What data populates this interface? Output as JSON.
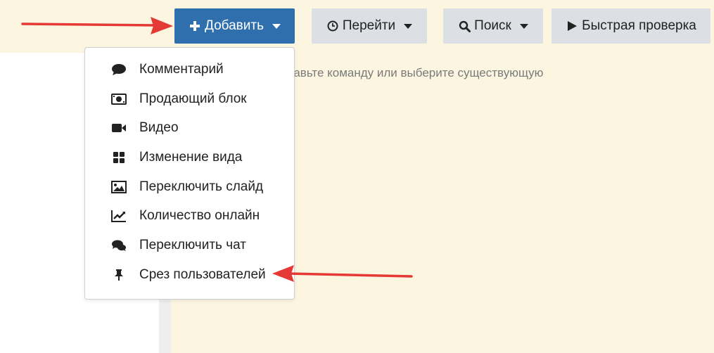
{
  "toolbar": {
    "add_label": "Добавить",
    "go_label": "Перейти",
    "search_label": "Поиск",
    "quick_check_label": "Быстрая проверка"
  },
  "main": {
    "hint": "бавьте команду или выберите существующую"
  },
  "menu": {
    "items": [
      {
        "label": "Комментарий",
        "icon": "comment-icon"
      },
      {
        "label": "Продающий блок",
        "icon": "money-icon"
      },
      {
        "label": "Видео",
        "icon": "video-camera-icon"
      },
      {
        "label": "Изменение вида",
        "icon": "grid-icon"
      },
      {
        "label": "Переключить слайд",
        "icon": "image-icon"
      },
      {
        "label": "Количество онлайн",
        "icon": "line-chart-icon"
      },
      {
        "label": "Переключить чат",
        "icon": "chat-bubbles-icon"
      },
      {
        "label": "Срез пользователей",
        "icon": "pin-icon"
      }
    ]
  },
  "colors": {
    "accent": "#2f6fae",
    "background": "#fcf6e1",
    "arrow": "#e53935"
  }
}
